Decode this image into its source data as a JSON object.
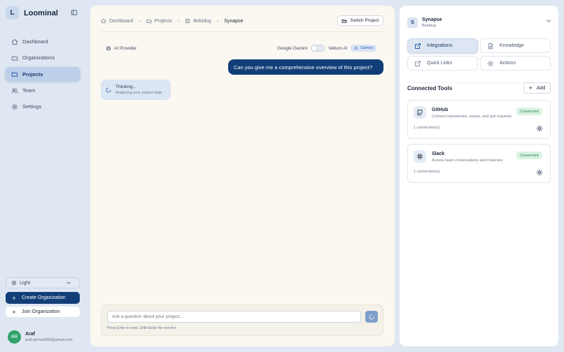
{
  "app": {
    "brand_initial": "L",
    "brand_name": "Loominal"
  },
  "sidebar": {
    "items": [
      {
        "label": "Dashboard",
        "icon": "home-icon"
      },
      {
        "label": "Organizations",
        "icon": "folder-icon"
      },
      {
        "label": "Projects",
        "icon": "folder-icon",
        "active": true
      },
      {
        "label": "Team",
        "icon": "users-icon"
      },
      {
        "label": "Settings",
        "icon": "gear-icon"
      }
    ],
    "theme_label": "Light",
    "create_label": "Create Organization",
    "join_label": "Join Organization",
    "user": {
      "initials": "AR",
      "name": "Araf",
      "email": "araf.ahmed200@gmail.com"
    }
  },
  "main": {
    "breadcrumbs": [
      "Dashboard",
      "Projects",
      "Bebidog",
      "Synapse"
    ],
    "switch_label": "Switch Project",
    "provider_label": "AI Provider",
    "toggle_left": "Google Gemini",
    "toggle_right": "Vellum AI",
    "provider_badge": "Gemini",
    "user_message": "Can you give me a comprehensive overview of this project?",
    "thinking_title": "Thinking...",
    "thinking_sub": "Analyzing your project data",
    "input_placeholder": "Ask a question about your project...",
    "input_hint": "Press Enter to send, Shift+Enter for new line"
  },
  "right": {
    "project_initial": "S",
    "project_name": "Synapse",
    "project_org": "Bebidog",
    "tabs": [
      {
        "label": "Integrations",
        "icon": "external-link-icon",
        "active": true
      },
      {
        "label": "Knowledge",
        "icon": "document-icon"
      },
      {
        "label": "Quick Links",
        "icon": "external-link-icon"
      },
      {
        "label": "Actions",
        "icon": "gear-icon"
      }
    ],
    "section_title": "Connected Tools",
    "add_label": "Add",
    "tools": [
      {
        "name": "GitHub",
        "description": "Connect repositories, issues, and pull requests",
        "status": "Connected",
        "connections": "1 connection(s)",
        "icon": "github-icon"
      },
      {
        "name": "Slack",
        "description": "Access team conversations and channels",
        "status": "Connected",
        "connections": "1 connection(s)",
        "icon": "slack-icon"
      }
    ]
  },
  "colors": {
    "accent": "#123e78",
    "connected": "#2b8a50",
    "panel": "#fbf8f1",
    "background": "#dfe7f2"
  }
}
